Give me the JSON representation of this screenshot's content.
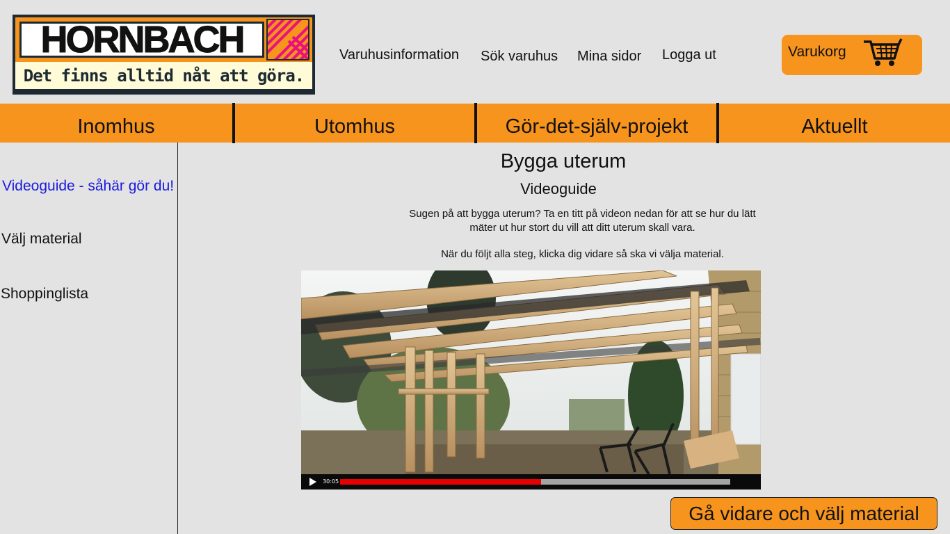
{
  "logo": {
    "brand": "HORNBACH",
    "slogan": "Det finns alltid nåt att göra."
  },
  "header": {
    "links": [
      "Varuhusinformation",
      "Sök varuhus",
      "Mina sidor",
      "Logga ut"
    ],
    "cart_label": "Varukorg"
  },
  "nav": {
    "items": [
      "Inomhus",
      "Utomhus",
      "Gör-det-själv-projekt",
      "Aktuellt"
    ]
  },
  "sidebar": {
    "items": [
      {
        "label": "Videoguide - såhär gör du!",
        "active": true
      },
      {
        "label": "Välj material",
        "active": false
      },
      {
        "label": "Shoppinglista",
        "active": false
      }
    ]
  },
  "main": {
    "title": "Bygga uterum",
    "subtitle": "Videoguide",
    "intro_line1": "Sugen på att bygga uterum? Ta en titt på videon nedan för att se hur du lätt",
    "intro_line2": "mäter ut hur stort du vill att ditt uterum skall vara.",
    "instruction": "När du följt alla steg, klicka dig vidare så ska vi välja material."
  },
  "video": {
    "time": "30:05",
    "progress": 0.515,
    "play_icon": "play-icon"
  },
  "next_button": "Gå vidare och välj material",
  "colors": {
    "accent": "#f7941d",
    "active_link": "#1a1adf",
    "progress": "#e60000"
  }
}
